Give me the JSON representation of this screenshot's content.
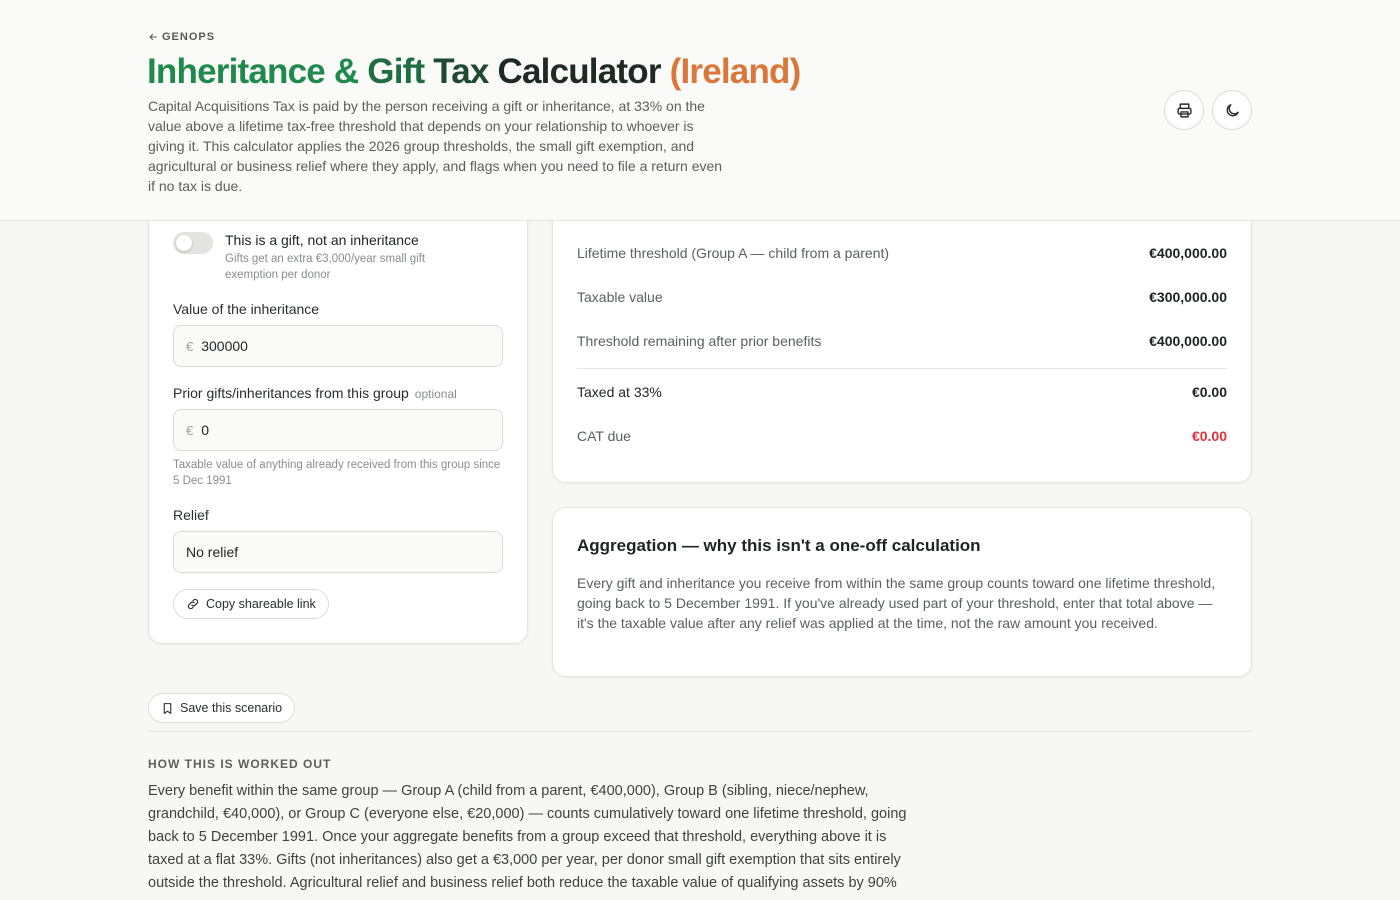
{
  "header": {
    "back_label": "GENOPS",
    "title_part1": "Inheritance & Gift Tax Calculator",
    "title_part2": " (Ireland)",
    "subtitle": "Capital Acquisitions Tax is paid by the person receiving a gift or inheritance, at 33% on the value above a lifetime tax-free threshold that depends on your relationship to whoever is giving it. This calculator applies the 2026 group thresholds, the small gift exemption, and agricultural or business relief where they apply, and flags when you need to file a return even if no tax is due.",
    "print_icon": "printer-icon",
    "theme_icon": "moon-icon"
  },
  "inputs": {
    "gift_toggle": {
      "label": "This is a gift, not an inheritance",
      "hint": "Gifts get an extra €3,000/year small gift exemption per donor",
      "checked": false
    },
    "value": {
      "label": "Value of the inheritance",
      "currency": "€",
      "value": "300000"
    },
    "prior": {
      "label": "Prior gifts/inheritances from this group",
      "optional": "optional",
      "currency": "€",
      "value": "0",
      "hint": "Taxable value of anything already received from this group since 5 Dec 1991"
    },
    "relief": {
      "label": "Relief",
      "selected": "No relief"
    },
    "copy_link_label": "Copy shareable link"
  },
  "results": {
    "rows": [
      {
        "label": "Lifetime threshold (Group A — child from a parent)",
        "value": "€400,000.00"
      },
      {
        "label": "Taxable value",
        "value": "€300,000.00"
      },
      {
        "label": "Threshold remaining after prior benefits",
        "value": "€400,000.00"
      },
      {
        "label": "Taxed at 33%",
        "value": "€0.00"
      },
      {
        "label": "CAT due",
        "value": "€0.00"
      }
    ],
    "due_color": "#e0313d"
  },
  "aggregation": {
    "title": "Aggregation — why this isn't a one-off calculation",
    "body": "Every gift and inheritance you receive from within the same group counts toward one lifetime threshold, going back to 5 December 1991. If you've already used part of your threshold, enter that total above — it's the taxable value after any relief was applied at the time, not the raw amount you received."
  },
  "save_label": "Save this scenario",
  "how": {
    "heading": "HOW THIS IS WORKED OUT",
    "body": "Every benefit within the same group — Group A (child from a parent, €400,000), Group B (sibling, niece/nephew, grandchild, €40,000), or Group C (everyone else, €20,000) — counts cumulatively toward one lifetime threshold, going back to 5 December 1991. Once your aggregate benefits from a group exceed that threshold, everything above it is taxed at a flat 33%. Gifts (not inheritances) also get a €3,000 per year, per donor small gift exemption that sits entirely outside the threshold. Agricultural relief and business relief both reduce the taxable value of qualifying assets by 90%"
  },
  "colors": {
    "title_green": "#1f8a4c",
    "title_orange": "#d9783a"
  }
}
